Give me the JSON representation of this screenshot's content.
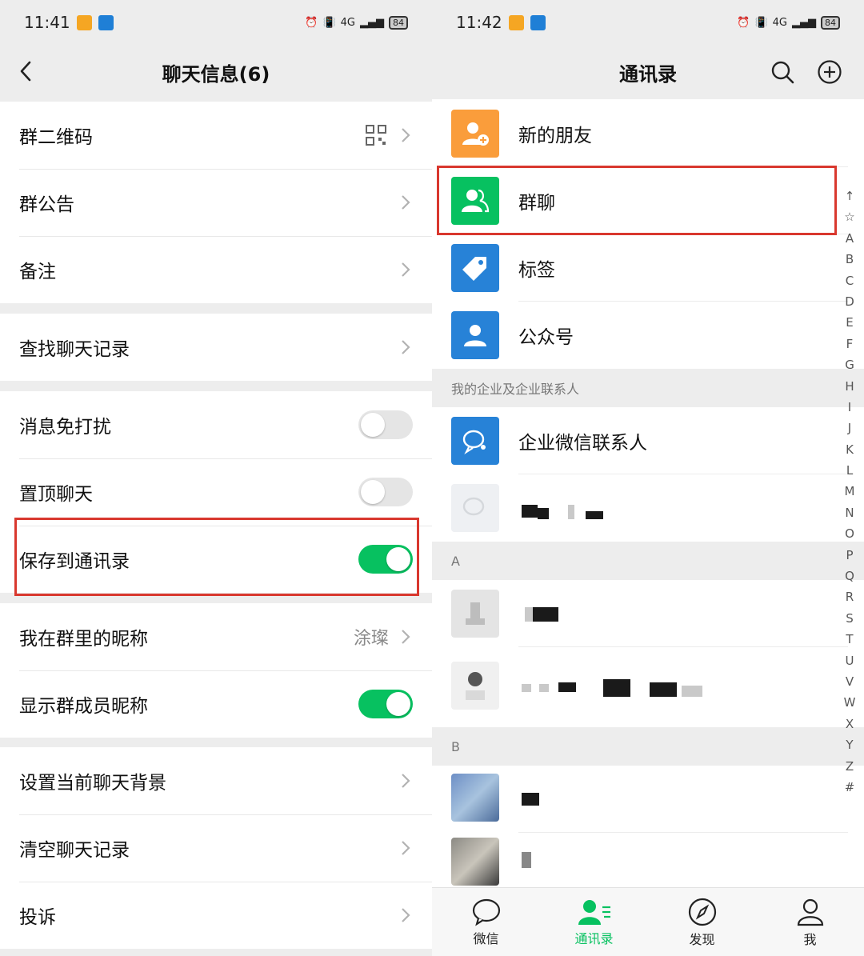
{
  "left": {
    "status": {
      "time": "11:41",
      "battery": "84",
      "network": "4G"
    },
    "nav": {
      "title": "聊天信息(6)"
    },
    "rows": {
      "qrcode": "群二维码",
      "notice": "群公告",
      "remark": "备注",
      "search": "查找聊天记录",
      "mute": "消息免打扰",
      "pin": "置顶聊天",
      "save": "保存到通讯录",
      "nickname": "我在群里的昵称",
      "nickname_value": "涂璨",
      "show_names": "显示群成员昵称",
      "background": "设置当前聊天背景",
      "clear": "清空聊天记录",
      "report": "投诉"
    },
    "toggles": {
      "mute": false,
      "pin": false,
      "save": true,
      "show_names": true
    }
  },
  "right": {
    "status": {
      "time": "11:42",
      "battery": "84",
      "network": "4G"
    },
    "nav": {
      "title": "通讯录"
    },
    "items": {
      "new_friends": "新的朋友",
      "group_chats": "群聊",
      "tags": "标签",
      "official": "公众号",
      "wecom": "企业微信联系人"
    },
    "sections": {
      "enterprise": "我的企业及企业联系人",
      "a": "A",
      "b": "B"
    },
    "index": [
      "↑",
      "☆",
      "A",
      "B",
      "C",
      "D",
      "E",
      "F",
      "G",
      "H",
      "I",
      "J",
      "K",
      "L",
      "M",
      "N",
      "O",
      "P",
      "Q",
      "R",
      "S",
      "T",
      "U",
      "V",
      "W",
      "X",
      "Y",
      "Z",
      "#"
    ],
    "tabs": {
      "chats": "微信",
      "contacts": "通讯录",
      "discover": "发现",
      "me": "我"
    },
    "colors": {
      "accent": "#07c160",
      "orange": "#fa9d3b",
      "blue": "#2782d7",
      "highlight": "#d9382e"
    }
  }
}
